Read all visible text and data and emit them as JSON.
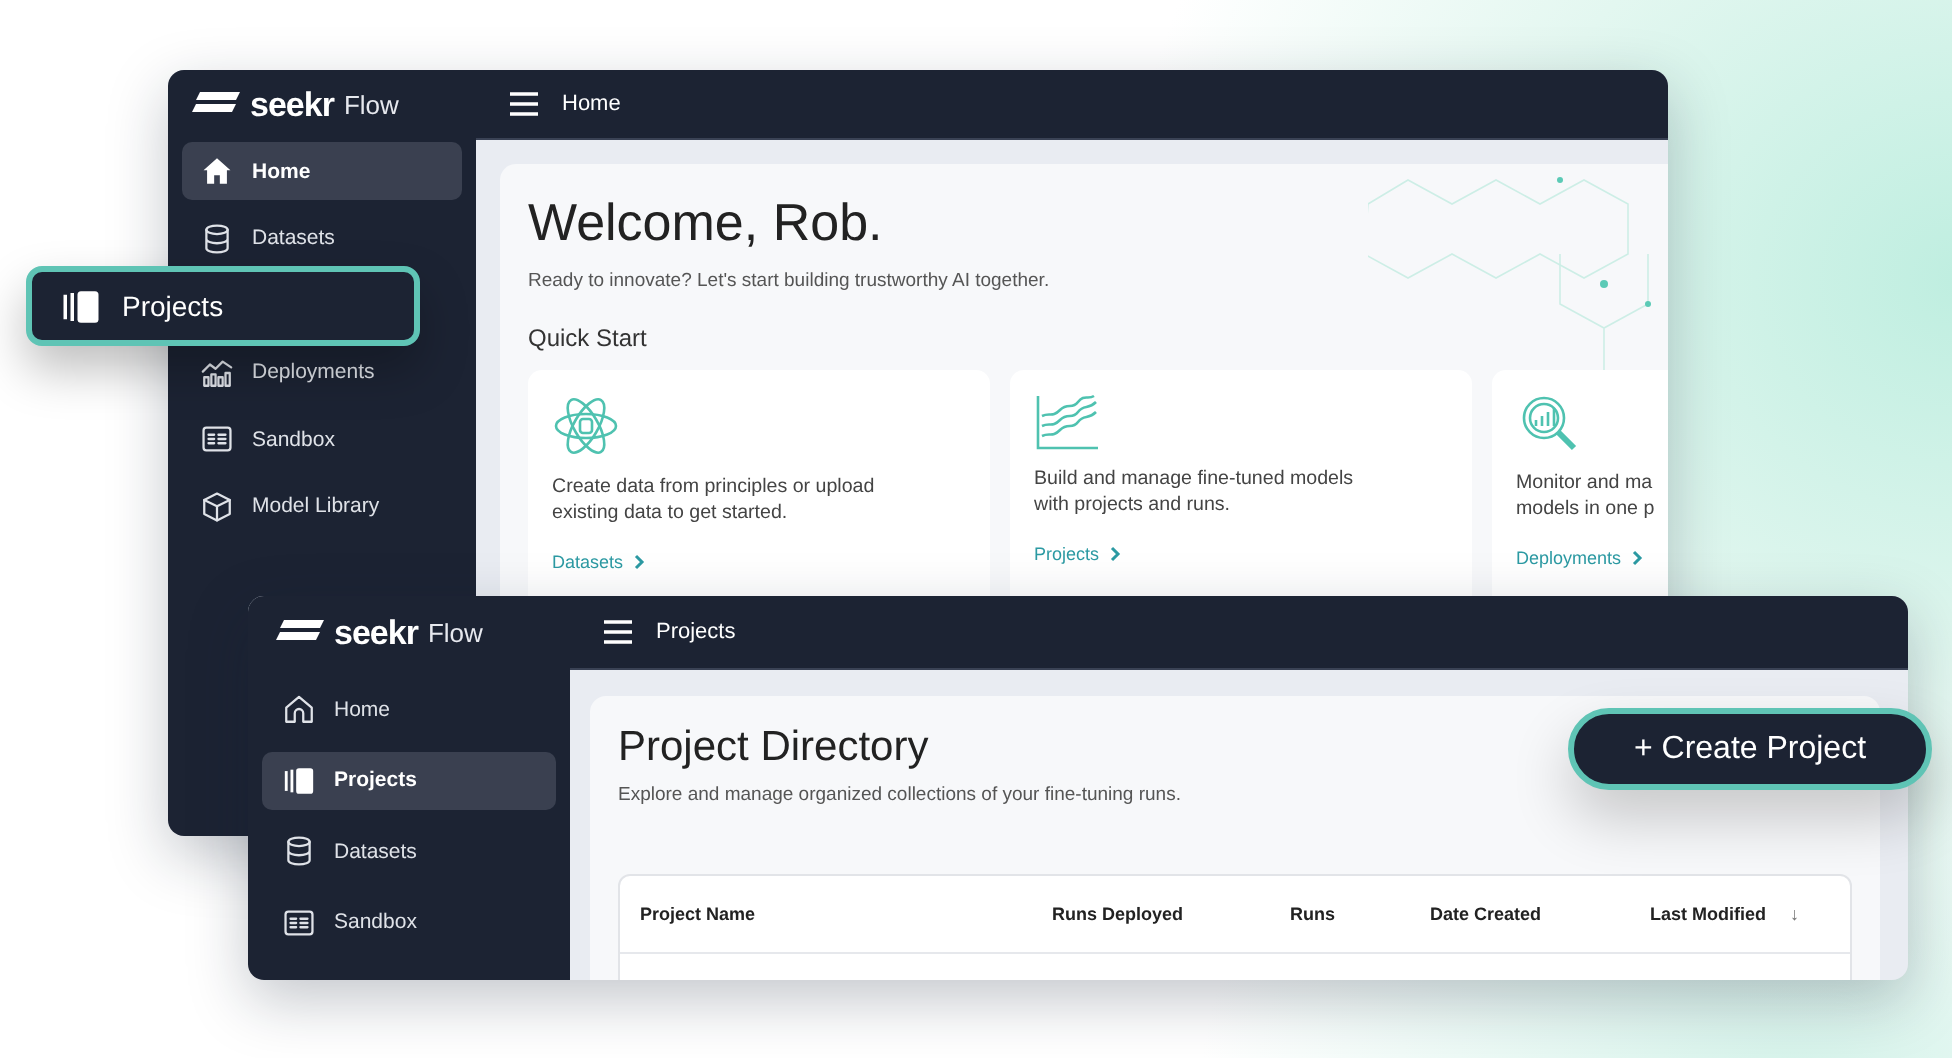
{
  "home_window": {
    "logo": {
      "brand": "seekr",
      "product": "Flow"
    },
    "breadcrumb": "Home",
    "sidebar": [
      {
        "label": "Home",
        "kind": "home",
        "selected": true,
        "highlighted": false
      },
      {
        "label": "Datasets",
        "kind": "database",
        "selected": false,
        "highlighted": false
      },
      {
        "label": "Projects",
        "kind": "projects",
        "selected": false,
        "highlighted": true
      },
      {
        "label": "Deployments",
        "kind": "chart",
        "selected": false,
        "highlighted": false
      },
      {
        "label": "Sandbox",
        "kind": "sandbox",
        "selected": false,
        "highlighted": false
      },
      {
        "label": "Model Library",
        "kind": "cube",
        "selected": false,
        "highlighted": false
      }
    ],
    "title": "Welcome, Rob.",
    "subtitle": "Ready to innovate? Let's start building trustworthy AI together.",
    "section": "Quick Start",
    "cards": [
      {
        "kind": "atom",
        "lines": [
          "Create data from principles or upload",
          "existing data to get started."
        ],
        "link": "Datasets"
      },
      {
        "kind": "linechart",
        "lines": [
          "Build and manage fine-tuned models",
          "with projects and runs."
        ],
        "link": "Projects"
      },
      {
        "kind": "magnifier",
        "lines": [
          "Monitor and ma",
          "models in one p"
        ],
        "link": "Deployments"
      }
    ]
  },
  "projects_window": {
    "logo": {
      "brand": "seekr",
      "product": "Flow"
    },
    "breadcrumb": "Projects",
    "sidebar": [
      {
        "label": "Home",
        "kind": "home",
        "selected": false,
        "highlighted": false
      },
      {
        "label": "Projects",
        "kind": "projects",
        "selected": true,
        "highlighted": false
      },
      {
        "label": "Datasets",
        "kind": "database",
        "selected": false,
        "highlighted": false
      },
      {
        "label": "Sandbox",
        "kind": "sandbox",
        "selected": false,
        "highlighted": false
      }
    ],
    "title": "Project Directory",
    "subtitle": "Explore and manage organized collections of your fine-tuning runs.",
    "table": {
      "columns": [
        {
          "label": "Project Name"
        },
        {
          "label": "Runs Deployed"
        },
        {
          "label": "Runs"
        },
        {
          "label": "Date Created"
        },
        {
          "label": "Last Modified",
          "sort_mark": "↓"
        }
      ]
    }
  },
  "create_button": {
    "label": "+ Create Project"
  }
}
